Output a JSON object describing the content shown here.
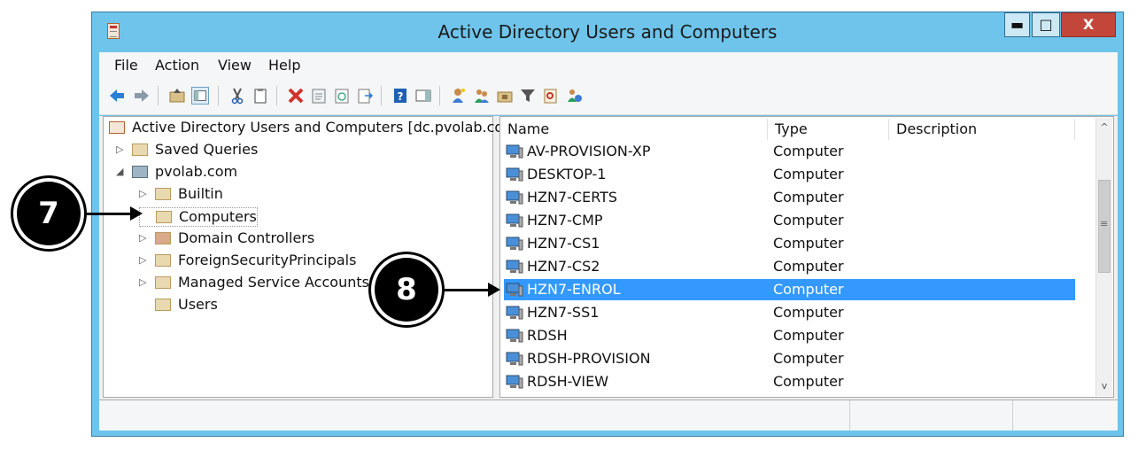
{
  "window": {
    "title": "Active Directory Users and Computers"
  },
  "window_controls": {
    "minimize": "▬",
    "maximize": "□",
    "close": "X"
  },
  "menu": [
    "File",
    "Action",
    "View",
    "Help"
  ],
  "tree": {
    "root": "Active Directory Users and Computers [dc.pvolab.com]",
    "items": [
      {
        "label": "Saved Queries",
        "expander": "▷"
      },
      {
        "label": "pvolab.com",
        "expander": "◢"
      },
      {
        "label": "Builtin",
        "expander": "▷"
      },
      {
        "label": "Computers",
        "expander": ""
      },
      {
        "label": "Domain Controllers",
        "expander": "▷"
      },
      {
        "label": "ForeignSecurityPrincipals",
        "expander": "▷"
      },
      {
        "label": "Managed Service Accounts",
        "expander": "▷"
      },
      {
        "label": "Users",
        "expander": ""
      }
    ]
  },
  "list": {
    "columns": [
      "Name",
      "Type",
      "Description"
    ],
    "rows": [
      {
        "name": "AV-PROVISION-XP",
        "type": "Computer"
      },
      {
        "name": "DESKTOP-1",
        "type": "Computer"
      },
      {
        "name": "HZN7-CERTS",
        "type": "Computer"
      },
      {
        "name": "HZN7-CMP",
        "type": "Computer"
      },
      {
        "name": "HZN7-CS1",
        "type": "Computer"
      },
      {
        "name": "HZN7-CS2",
        "type": "Computer"
      },
      {
        "name": "HZN7-ENROL",
        "type": "Computer"
      },
      {
        "name": "HZN7-SS1",
        "type": "Computer"
      },
      {
        "name": "RDSH",
        "type": "Computer"
      },
      {
        "name": "RDSH-PROVISION",
        "type": "Computer"
      },
      {
        "name": "RDSH-VIEW",
        "type": "Computer"
      }
    ],
    "selected_row": "HZN7-ENROL"
  },
  "scrollbar": {
    "up": "^",
    "down": "v",
    "grip": "≡"
  },
  "callouts": [
    "7",
    "8"
  ],
  "colors": {
    "titlebar": "#6ec4ea",
    "selection": "#3399ff",
    "close": "#c2473a"
  }
}
